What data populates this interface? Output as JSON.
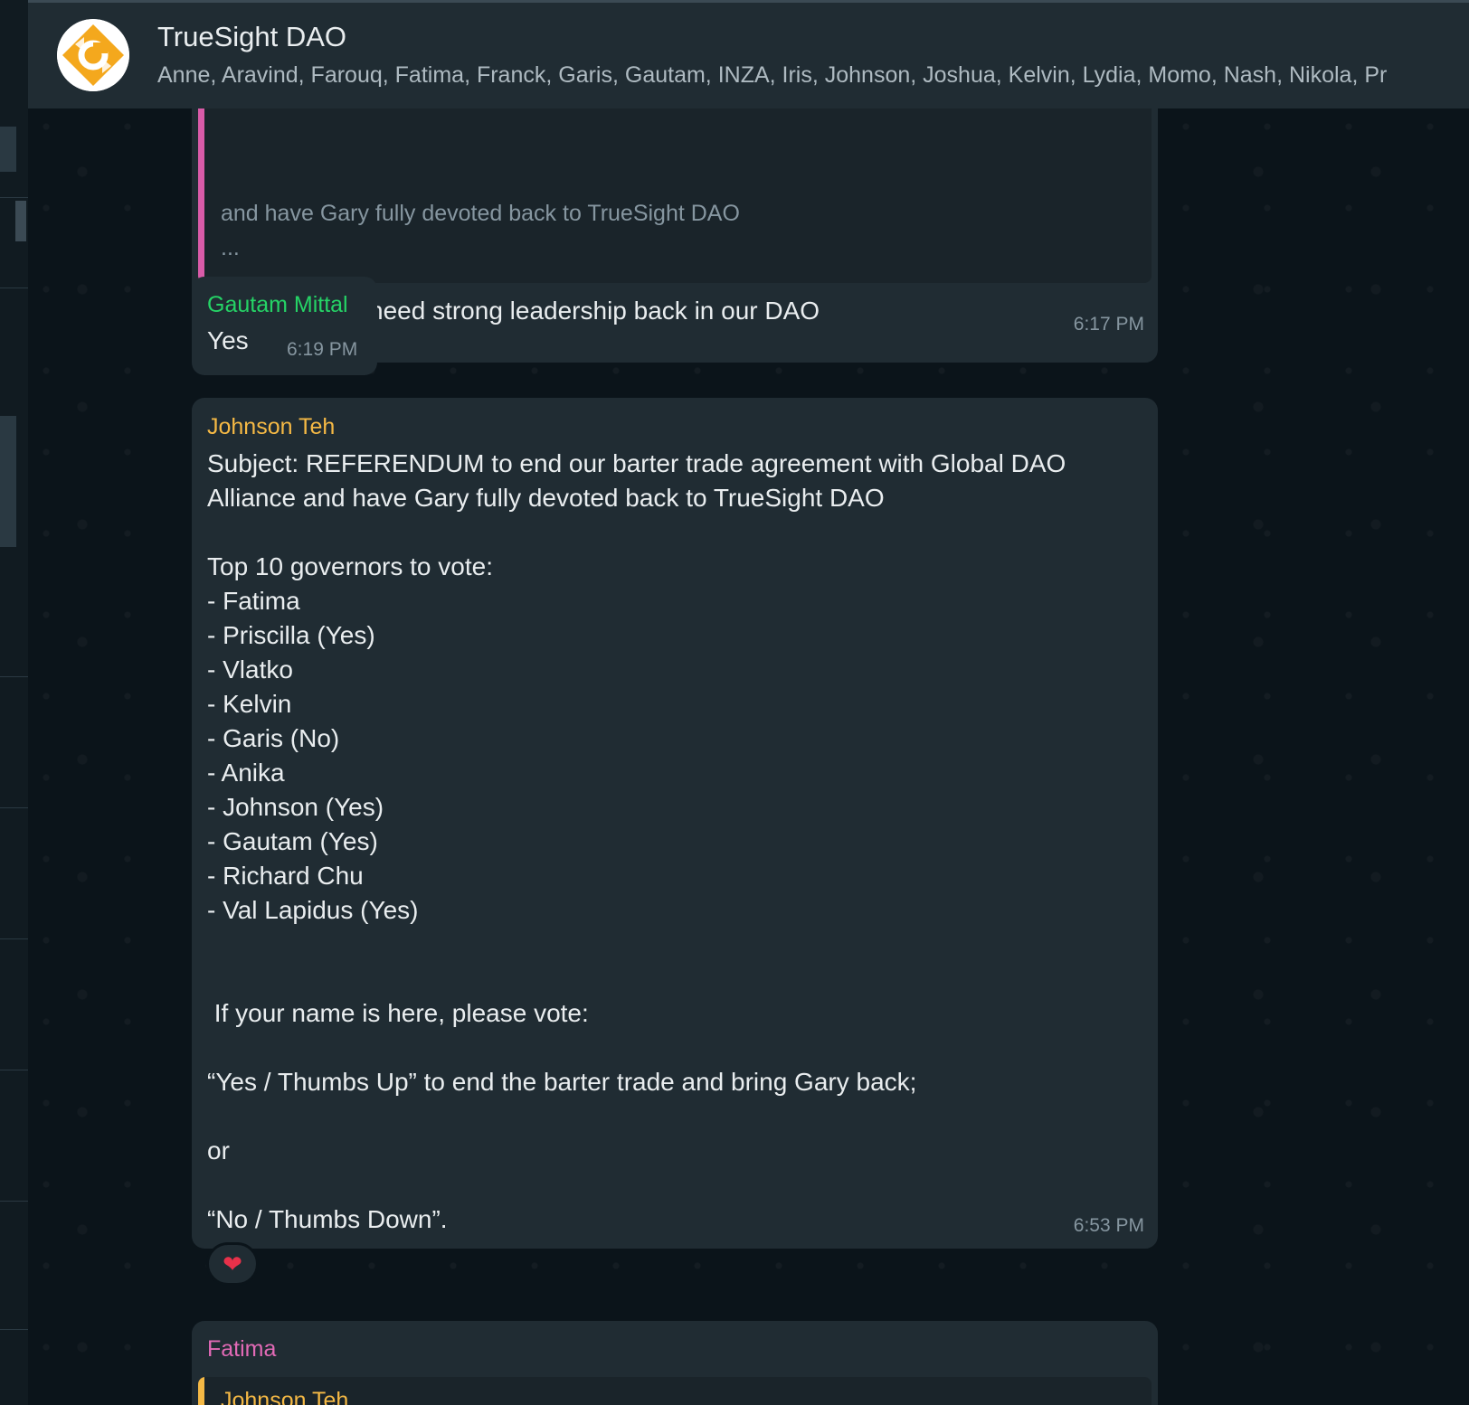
{
  "header": {
    "title": "TrueSight DAO",
    "members": "Anne, Aravind, Farouq, Fatima, Franck, Garis, Gautam, INZA, Iris, Johnson, Joshua, Kelvin, Lydia, Momo, Nash, Nikola, Pr"
  },
  "messages": [
    {
      "quote": {
        "line1": "and have Gary fully devoted back to TrueSight DAO",
        "line2": "..."
      },
      "text": "i vote Yes, we need strong leadership back in our DAO",
      "time": "6:17 PM"
    },
    {
      "sender": "Gautam Mittal",
      "text": "Yes",
      "time": "6:19 PM"
    },
    {
      "sender": "Johnson Teh",
      "text": "Subject: REFERENDUM to end our barter trade agreement with Global DAO\nAlliance and have Gary fully devoted back to TrueSight DAO\n\nTop 10 governors to vote:\n- Fatima\n- Priscilla (Yes)\n- Vlatko\n- Kelvin\n- Garis (No)\n- Anika\n- Johnson (Yes)\n- Gautam (Yes)\n- Richard Chu\n- Val Lapidus (Yes)\n\n\n If your name is here, please vote:\n\n“Yes / Thumbs Up” to end the barter trade and bring Gary back;\n\nor\n\n“No / Thumbs Down”.",
      "time": "6:53 PM",
      "reaction": "❤"
    },
    {
      "sender": "Fatima",
      "quote_sender": "Johnson Teh"
    }
  ],
  "colors": {
    "gautam_sender": "#25d366",
    "johnson_sender": "#f5b945",
    "fatima_sender": "#e26ab6",
    "quote_bar_pink": "#d95ba8",
    "quote_bar_orange": "#f5b945",
    "avatar_orange": "#f4a81d"
  }
}
